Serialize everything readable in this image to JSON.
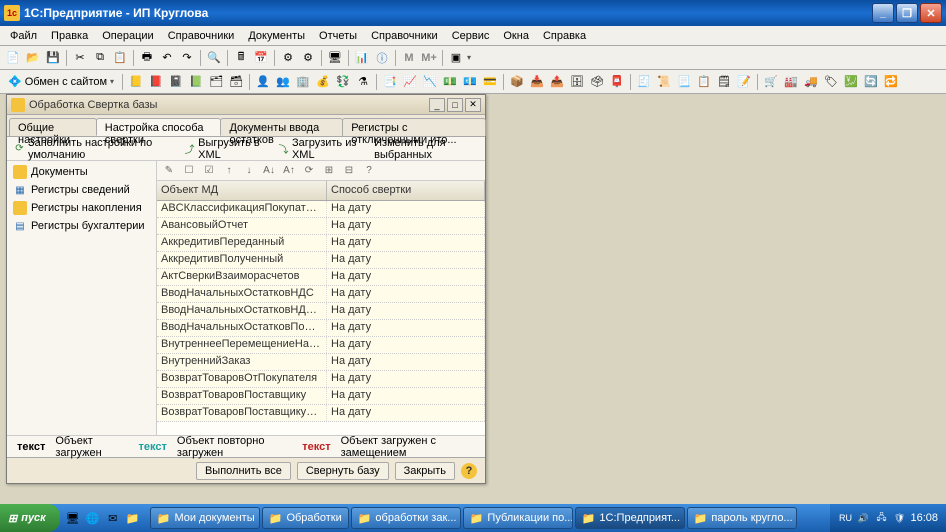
{
  "window": {
    "title": "1С:Предприятие - ИП Круглова"
  },
  "menu": [
    "Файл",
    "Правка",
    "Операции",
    "Справочники",
    "Документы",
    "Отчеты",
    "Справочники",
    "Сервис",
    "Окна",
    "Справка"
  ],
  "toolbar2_label": "Обмен с сайтом",
  "inner": {
    "title": "Обработка  Свертка базы",
    "tabs": [
      "Общие настройки",
      "Настройка способа свертки",
      "Документы ввода остатков",
      "Регистры с отключенными ито..."
    ],
    "active_tab": 1,
    "subtoolbar": {
      "fill_defaults": "Заполнить настройки по умолчанию",
      "export_xml": "Выгрузить в XML",
      "import_xml": "Загрузить из XML",
      "edit_selected": "Изменить для выбранных"
    },
    "nav": [
      "Документы",
      "Регистры сведений",
      "Регистры накопления",
      "Регистры бухгалтерии"
    ],
    "grid": {
      "columns": [
        "Объект МД",
        "Способ свертки"
      ],
      "rows": [
        {
          "obj": "ABCКлассификацияПокупателей",
          "mode": "На дату"
        },
        {
          "obj": "АвансовыйОтчет",
          "mode": "На дату"
        },
        {
          "obj": "АккредитивПереданный",
          "mode": "На дату"
        },
        {
          "obj": "АккредитивПолученный",
          "mode": "На дату"
        },
        {
          "obj": "АктСверкиВзаиморасчетов",
          "mode": "На дату"
        },
        {
          "obj": "ВводНачальныхОстатковНДС",
          "mode": "На дату"
        },
        {
          "obj": "ВводНачальныхОстатковНДСпоПарт...",
          "mode": "На дату"
        },
        {
          "obj": "ВводНачальныхОстатковПоВзаимор...",
          "mode": "На дату"
        },
        {
          "obj": "ВнутреннееПеремещениеНаличныхД...",
          "mode": "На дату"
        },
        {
          "obj": "ВнутреннийЗаказ",
          "mode": "На дату"
        },
        {
          "obj": "ВозвратТоваровОтПокупателя",
          "mode": "На дату"
        },
        {
          "obj": "ВозвратТоваровПоставщику",
          "mode": "На дату"
        },
        {
          "obj": "ВозвратТоваровПоставщикуИзНТТ",
          "mode": "На дату"
        }
      ]
    },
    "legend": {
      "label": "текст",
      "loaded": "Объект загружен",
      "reloaded": "Объект повторно загружен",
      "replaced": "Объект загружен с замещением"
    },
    "buttons": {
      "run_all": "Выполнить все",
      "collapse": "Свернуть базу",
      "close": "Закрыть"
    }
  },
  "taskbar": {
    "start": "пуск",
    "items": [
      "Мои документы",
      "Обработки",
      "обработки зак...",
      "Публикации по...",
      "1С:Предприят...",
      "пароль кругло..."
    ],
    "active": 4,
    "lang": "RU",
    "clock": "16:08"
  }
}
